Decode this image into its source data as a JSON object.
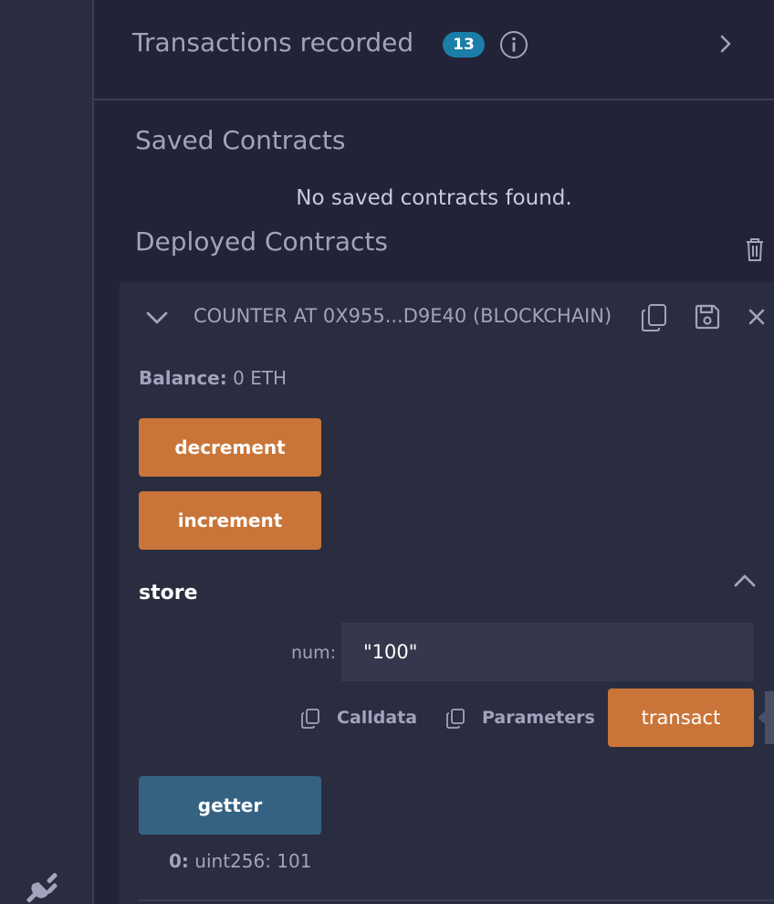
{
  "transactions": {
    "title": "Transactions recorded",
    "count": "13"
  },
  "saved": {
    "title": "Saved Contracts",
    "empty_message": "No saved contracts found."
  },
  "deployed": {
    "title": "Deployed Contracts",
    "contract": {
      "name": "COUNTER AT 0X955...D9E40 (BLOCKCHAIN)",
      "balance_label": "Balance:",
      "balance_value": "0 ETH",
      "functions": {
        "decrement": "decrement",
        "increment": "increment",
        "store": {
          "label": "store",
          "param_label": "num:",
          "param_value": "\"100\"",
          "calldata": "Calldata",
          "parameters": "Parameters",
          "transact": "transact"
        },
        "getter": {
          "label": "getter",
          "result_index": "0:",
          "result_value": "uint256: 101"
        }
      }
    }
  },
  "colors": {
    "background": "#222336",
    "panel": "#2a2c3f",
    "accent_orange": "#c97539",
    "accent_blue": "#356283",
    "badge": "#1a7ea8"
  },
  "icons": [
    "plug-icon",
    "info-icon",
    "chevron-right-icon",
    "trash-icon",
    "chevron-down-icon",
    "copy-icon",
    "save-icon",
    "close-icon",
    "chevron-up-icon"
  ]
}
